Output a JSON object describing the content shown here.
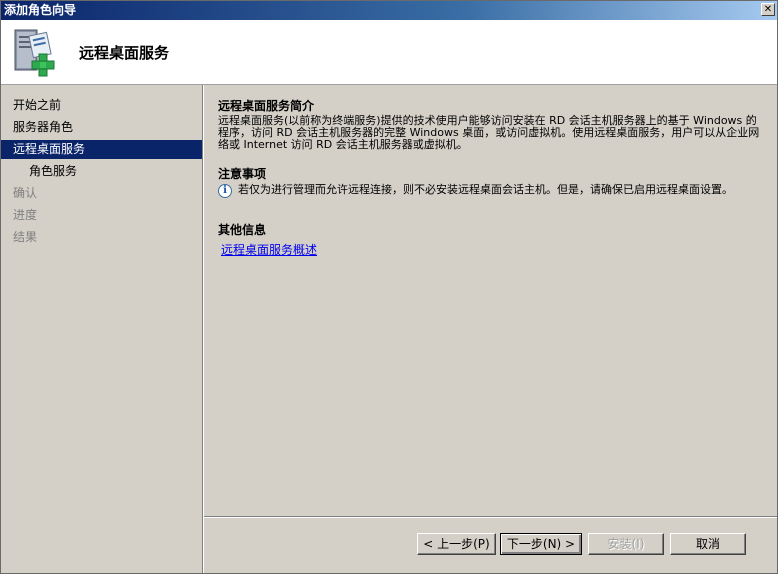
{
  "window": {
    "title": "添加角色向导"
  },
  "header": {
    "title": "远程桌面服务",
    "icon": "server-roles-add-icon"
  },
  "sidebar": {
    "items": [
      {
        "label": "开始之前",
        "state": "normal"
      },
      {
        "label": "服务器角色",
        "state": "normal"
      },
      {
        "label": "远程桌面服务",
        "state": "active"
      },
      {
        "label": "角色服务",
        "state": "normal"
      },
      {
        "label": "确认",
        "state": "disabled"
      },
      {
        "label": "进度",
        "state": "disabled"
      },
      {
        "label": "结果",
        "state": "disabled"
      }
    ]
  },
  "main": {
    "intro_title": "远程桌面服务简介",
    "intro_text": "远程桌面服务(以前称为终端服务)提供的技术使用户能够访问安装在 RD 会话主机服务器上的基于 Windows 的程序，访问 RD 会话主机服务器的完整 Windows 桌面，或访问虚拟机。使用远程桌面服务，用户可以从企业网络或 Internet 访问 RD 会话主机服务器或虚拟机。",
    "notes_title": "注意事项",
    "note_text": "若仅为进行管理而允许远程连接，则不必安装远程桌面会话主机。但是，请确保已启用远程桌面设置。",
    "more_title": "其他信息",
    "link_text": "远程桌面服务概述"
  },
  "buttons": {
    "back": "< 上一步(P)",
    "next": "下一步(N) >",
    "install": "安装(I)",
    "cancel": "取消"
  },
  "colors": {
    "active_nav": "#0a246a",
    "link": "#0000ee",
    "dialog_bg": "#d4d0c8"
  }
}
